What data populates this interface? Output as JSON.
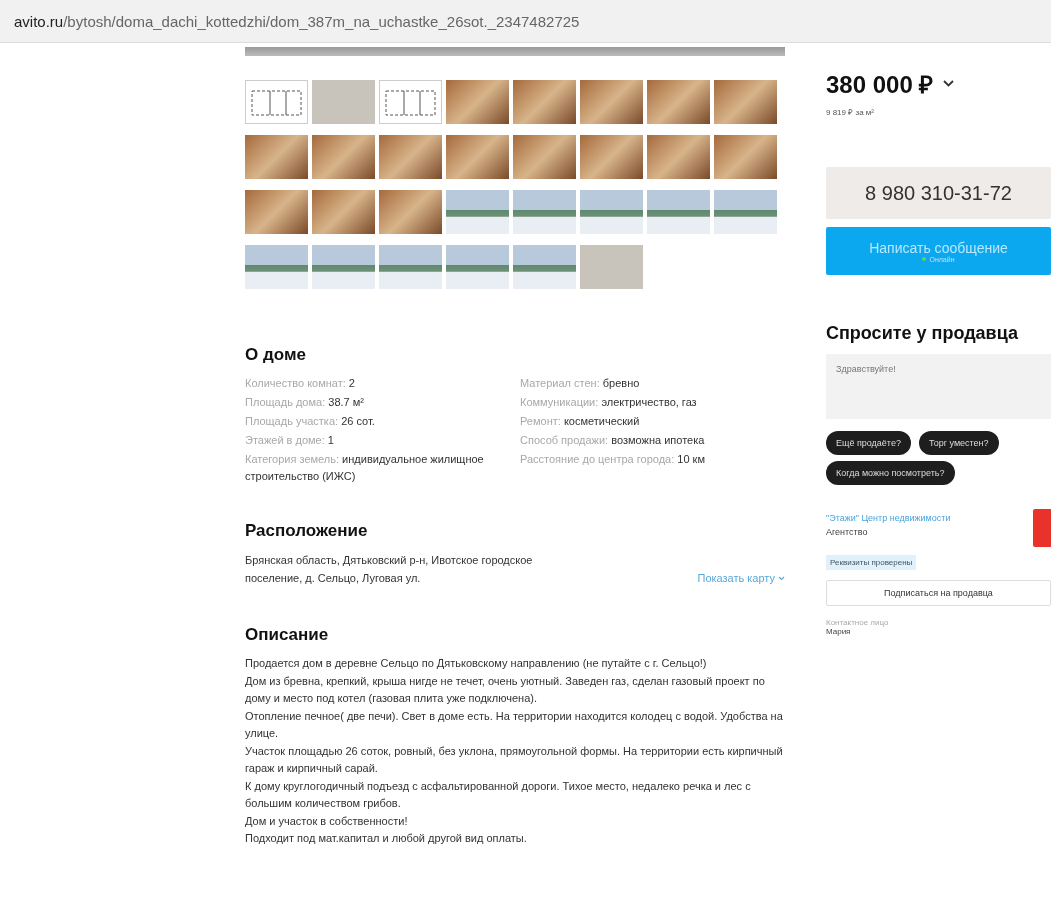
{
  "address_bar": {
    "url_host": "avito.ru",
    "url_path": "/bytosh/doma_dachi_kottedzhi/dom_387m_na_uchastke_26sot._2347482725"
  },
  "gallery": {
    "thumbnails": [
      {
        "kind": "plan"
      },
      {
        "kind": "blank"
      },
      {
        "kind": "plan"
      },
      {
        "kind": "interior"
      },
      {
        "kind": "interior"
      },
      {
        "kind": "interior"
      },
      {
        "kind": "interior"
      },
      {
        "kind": "interior"
      },
      {
        "kind": "interior"
      },
      {
        "kind": "interior"
      },
      {
        "kind": "interior"
      },
      {
        "kind": "interior"
      },
      {
        "kind": "interior"
      },
      {
        "kind": "interior"
      },
      {
        "kind": "interior"
      },
      {
        "kind": "interior"
      },
      {
        "kind": "interior"
      },
      {
        "kind": "interior"
      },
      {
        "kind": "interior"
      },
      {
        "kind": "exterior"
      },
      {
        "kind": "exterior"
      },
      {
        "kind": "exterior"
      },
      {
        "kind": "exterior"
      },
      {
        "kind": "exterior"
      },
      {
        "kind": "exterior"
      },
      {
        "kind": "exterior"
      },
      {
        "kind": "exterior"
      },
      {
        "kind": "exterior"
      },
      {
        "kind": "exterior"
      },
      {
        "kind": "blank"
      }
    ]
  },
  "about_house": {
    "title": "О доме",
    "params_left": [
      {
        "label": "Количество комнат:",
        "value": "2"
      },
      {
        "label": "Площадь дома:",
        "value": "38.7 м²"
      },
      {
        "label": "Площадь участка:",
        "value": "26 сот."
      },
      {
        "label": "Этажей в доме:",
        "value": "1"
      },
      {
        "label": "Категория земель:",
        "value": "индивидуальное жилищное строительство (ИЖС)"
      }
    ],
    "params_right": [
      {
        "label": "Материал стен:",
        "value": "бревно"
      },
      {
        "label": "Коммуникации:",
        "value": "электричество, газ"
      },
      {
        "label": "Ремонт:",
        "value": "косметический"
      },
      {
        "label": "Способ продажи:",
        "value": "возможна ипотека"
      },
      {
        "label": "Расстояние до центра города:",
        "value": "10 км"
      }
    ]
  },
  "location": {
    "title": "Расположение",
    "address": "Брянская область, Дятьковский р-н, Ивотское городское поселение, д. Сельцо, Луговая ул.",
    "map_link": "Показать карту"
  },
  "description": {
    "title": "Описание",
    "paragraphs": [
      "Продается дом в деревне Сельцо по Дятьковскому направлению (не путайте с г. Сельцо!)",
      "Дом из бревна, крепкий, крыша нигде не течет, очень уютный. Заведен газ, сделан газовый проект по дому и место под котел (газовая плита уже подключена).",
      "Отопление печное( две печи). Свет в доме есть. На территории находится колодец с водой. Удобства на улице.",
      "Участок площадью 26 соток, ровный, без уклона, прямоугольной формы. На территории есть кирпичный гараж и кирпичный сарай.",
      "К дому круглогодичный подъезд с асфальтированной дороги. Тихое место, недалеко речка и лес с большим количеством грибов.",
      "Дом и участок в собственности!",
      "Подходит под мат.капитал и любой другой вид оплаты."
    ]
  },
  "sidebar": {
    "price": "380 000 ₽",
    "price_per_m2": "9 819 ₽ за м²",
    "phone_button": "8 980 310-31-72",
    "message_button": {
      "label": "Написать сообщение",
      "status": "Онлайн"
    },
    "ask_seller": {
      "title": "Спросите у продавца",
      "message": "Здравствуйте!",
      "quick_replies": [
        "Ещё продаёте?",
        "Торг уместен?",
        "Когда можно посмотреть?"
      ]
    },
    "seller": {
      "name": "\"Этажи\" Центр недвижимости",
      "type": "Агентство",
      "badge": "Реквизиты проверены",
      "subscribe_button": "Подписаться на продавца"
    },
    "contact": {
      "label": "Контактное лицо",
      "name": "Мария"
    }
  }
}
